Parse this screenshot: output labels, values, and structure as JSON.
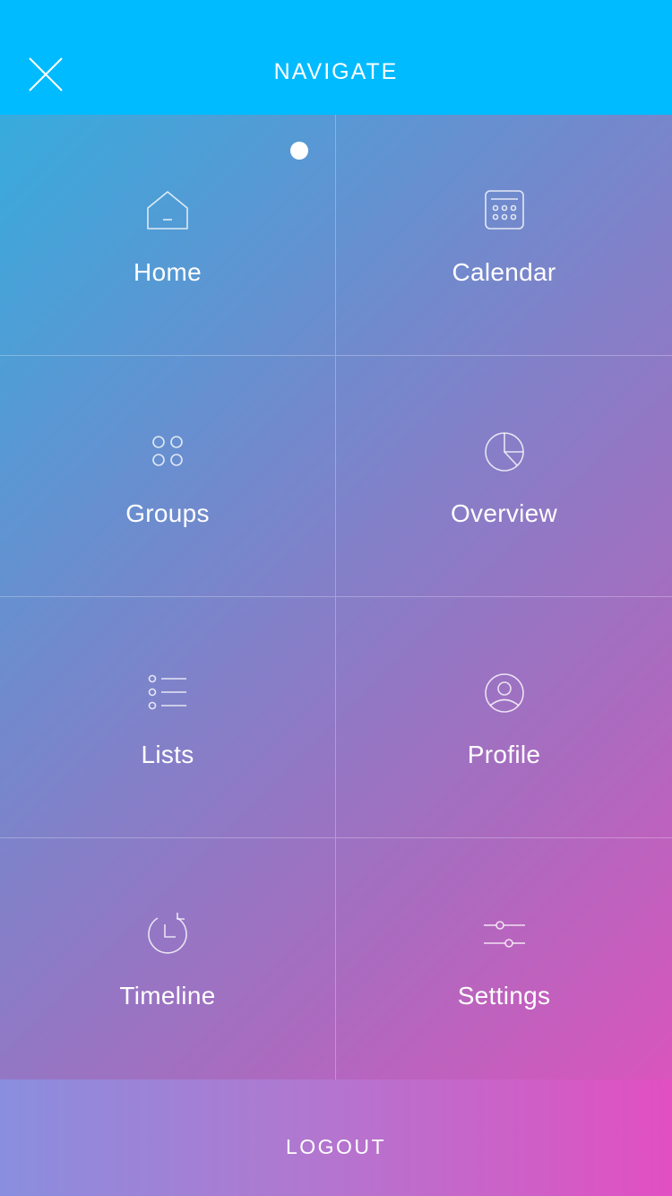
{
  "header": {
    "title": "NAVIGATE",
    "close_icon": "close-icon",
    "background": "#00bbff"
  },
  "menu": {
    "active_item": "Home",
    "items": [
      {
        "label": "Home",
        "icon": "home-icon"
      },
      {
        "label": "Calendar",
        "icon": "calendar-icon"
      },
      {
        "label": "Groups",
        "icon": "groups-icon"
      },
      {
        "label": "Overview",
        "icon": "pie-chart-icon"
      },
      {
        "label": "Lists",
        "icon": "list-icon"
      },
      {
        "label": "Profile",
        "icon": "user-icon"
      },
      {
        "label": "Timeline",
        "icon": "history-icon"
      },
      {
        "label": "Settings",
        "icon": "sliders-icon"
      }
    ]
  },
  "footer": {
    "logout_label": "LOGOUT"
  },
  "colors": {
    "gradient_start": "#2cb2e0",
    "gradient_end": "#e64fbc"
  }
}
